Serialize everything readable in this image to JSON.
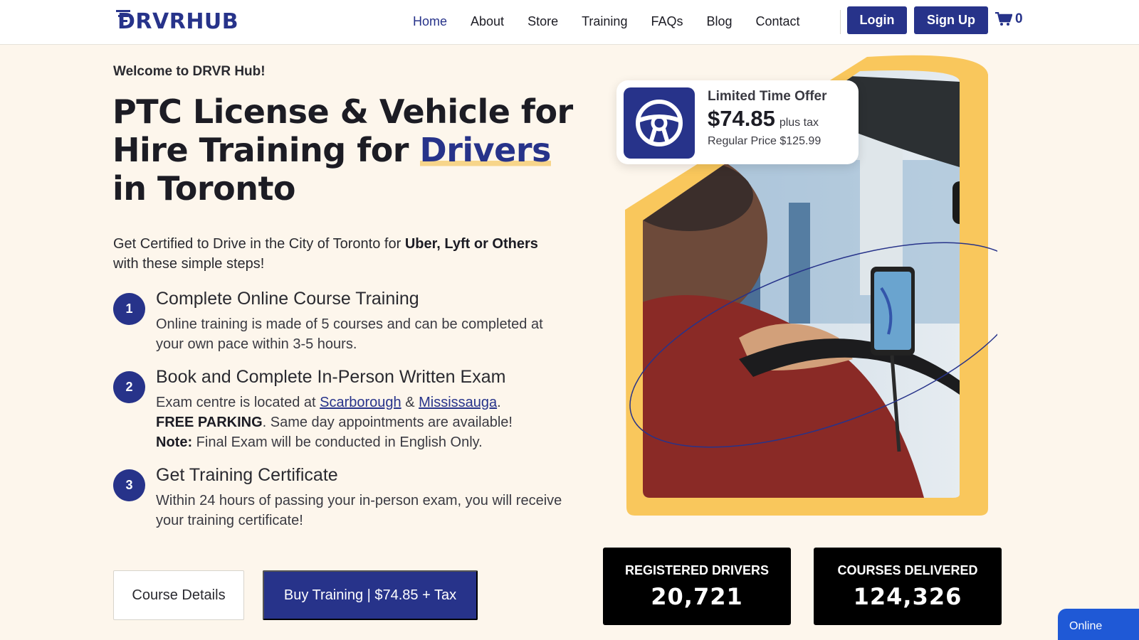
{
  "header": {
    "logo": "DRVRHUB",
    "nav": [
      "Home",
      "About",
      "Store",
      "Training",
      "FAQs",
      "Blog",
      "Contact"
    ],
    "login_label": "Login",
    "signup_label": "Sign Up",
    "cart_count": "0"
  },
  "hero": {
    "welcome": "Welcome to DRVR Hub!",
    "headline_part1": "PTC License & Vehicle for Hire Training for ",
    "headline_highlight": "Drivers",
    "headline_part2": " in Toronto",
    "intro_part1": "Get Certified to Drive in the City of Toronto for ",
    "intro_bold": "Uber, Lyft or Others",
    "intro_part2": " with these simple steps!"
  },
  "steps": [
    {
      "num": "1",
      "title": "Complete Online Course Training",
      "desc": "Online training is made of 5 courses and can be completed at your own pace within 3-5 hours."
    },
    {
      "num": "2",
      "title": "Book and Complete In-Person Written Exam",
      "desc_prefix": "Exam centre is located at ",
      "link1": "Scarborough",
      "amp": " & ",
      "link2": "Mississauga",
      "period": ".",
      "parking_bold": "FREE PARKING",
      "parking_rest": ". Same day appointments are available!",
      "note_bold": "Note:",
      "note_rest": " Final Exam will be conducted in English Only."
    },
    {
      "num": "3",
      "title": "Get Training Certificate",
      "desc": "Within 24 hours of passing your in-person exam, you will receive your training certificate!"
    }
  ],
  "buttons": {
    "details": "Course Details",
    "buy": "Buy Training | $74.85 + Tax"
  },
  "offer": {
    "label": "Limited Time Offer",
    "price": "$74.85",
    "tax": "plus tax",
    "regular": "Regular Price $125.99"
  },
  "stats": [
    {
      "label": "REGISTERED DRIVERS",
      "value": "20,721"
    },
    {
      "label": "COURSES DELIVERED",
      "value": "124,326"
    }
  ],
  "chat": {
    "label": "Online"
  },
  "colors": {
    "brand": "#27338a",
    "accent": "#f9c75c",
    "background": "#fdf6ec"
  }
}
